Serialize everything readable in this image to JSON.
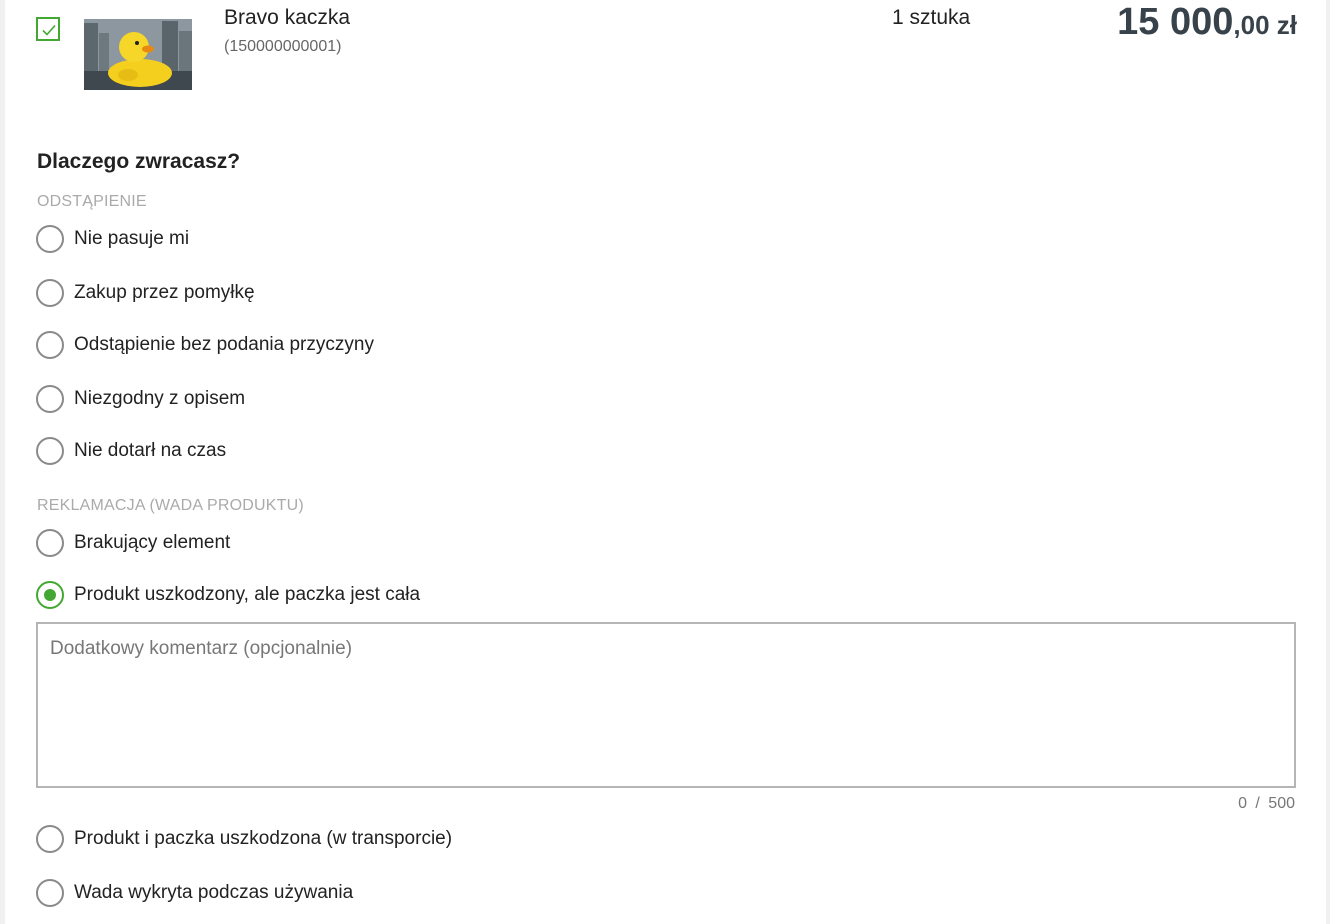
{
  "product": {
    "name": "Bravo kaczka",
    "code": "(150000000001)",
    "quantity": "1 sztuka",
    "price_integer": "15 000",
    "price_decimal": ",00",
    "price_currency": " zł",
    "selected": true
  },
  "reasons": {
    "question": "Dlaczego zwracasz?",
    "withdrawal_label": "ODSTĄPIENIE",
    "withdrawal_options": [
      "Nie pasuje mi",
      "Zakup przez pomyłkę",
      "Odstąpienie bez podania przyczyny",
      "Niezgodny z opisem",
      "Nie dotarł na czas"
    ],
    "complaint_label": "REKLAMACJA (WADA PRODUKTU)",
    "complaint_options": [
      "Brakujący element",
      "Produkt uszkodzony, ale paczka jest cała",
      "Produkt i paczka uszkodzona (w transporcie)",
      "Wada wykryta podczas używania"
    ],
    "selected_option": "Produkt uszkodzony, ale paczka jest cała"
  },
  "comment": {
    "placeholder": "Dodatkowy komentarz (opcjonalnie)",
    "value": "",
    "counter": "0 / 500"
  },
  "colors": {
    "accent": "#43a832",
    "price": "#37424a",
    "section_label": "#aaaaaa"
  }
}
